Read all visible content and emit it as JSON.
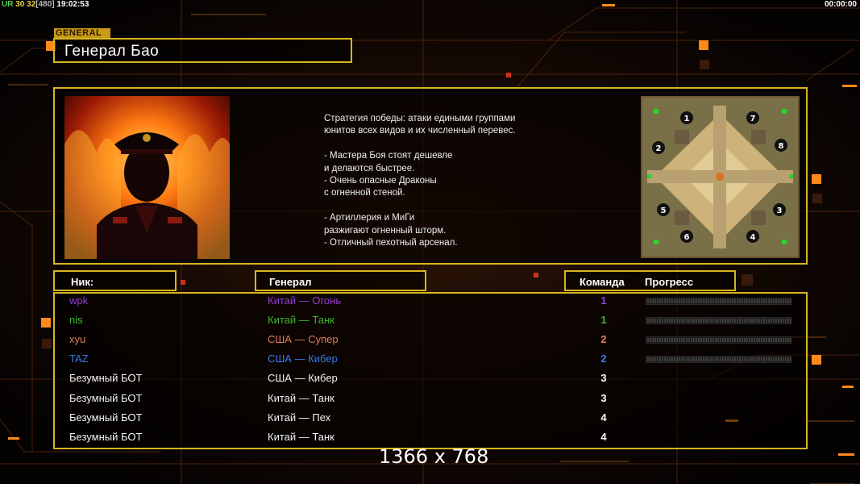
{
  "hud": {
    "top_left": [
      {
        "text": "UR",
        "color": "#4dd24d"
      },
      {
        "text": " 30",
        "color": "#e8d040"
      },
      {
        "text": " 32",
        "color": "#e8d040"
      },
      {
        "text": "[480]",
        "color": "#b8b8b8"
      },
      {
        "text": " 19:02:53",
        "color": "#ffffff"
      }
    ],
    "top_right": "00:00:00"
  },
  "general": {
    "tag": "GENERAL",
    "name": "Генерал Бао",
    "description": "Стратегия победы: атаки едиными группами\nюнитов всех видов и их численный перевес.\n\n- Мастера Боя стоят дешевле\nи делаются быстрее.\n- Очень опасные Драконы\nс огненной стеной.\n\n- Артиллерия и МиГи\nразжигают огненный шторм.\n- Отличный пехотный арсенал."
  },
  "minimap": {
    "slots": [
      "1",
      "2",
      "3",
      "4",
      "5",
      "6",
      "7",
      "8"
    ]
  },
  "table": {
    "headers": {
      "nick": "Ник:",
      "general": "Генерал",
      "team": "Команда",
      "progress": "Прогресс"
    },
    "rows": [
      {
        "nick": "wpk",
        "general": "Китай — Огонь",
        "team": "1",
        "color": "#9a3ad8",
        "progress": 0
      },
      {
        "nick": "nis",
        "general": "Китай — Танк",
        "team": "1",
        "color": "#3cba2c",
        "progress": 0
      },
      {
        "nick": "xyu",
        "general": "США — Супер",
        "team": "2",
        "color": "#e27a5a",
        "progress": 0
      },
      {
        "nick": "TAZ",
        "general": "США — Кибер",
        "team": "2",
        "color": "#3a78e8",
        "progress": 0
      },
      {
        "nick": "Безумный БОТ",
        "general": "США — Кибер",
        "team": "3",
        "color": "#f2f2f2",
        "progress": null
      },
      {
        "nick": "Безумный БОТ",
        "general": "Китай — Танк",
        "team": "3",
        "color": "#f2f2f2",
        "progress": null
      },
      {
        "nick": "Безумный БОТ",
        "general": "Китай — Пех",
        "team": "4",
        "color": "#f2f2f2",
        "progress": null
      },
      {
        "nick": "Безумный БОТ",
        "general": "Китай — Танк",
        "team": "4",
        "color": "#f2f2f2",
        "progress": null
      }
    ]
  },
  "resolution_label": "1366 x 768",
  "colors": {
    "accent": "#d8b520",
    "background": "#0b0605",
    "highlight": "#ff8a1a"
  }
}
